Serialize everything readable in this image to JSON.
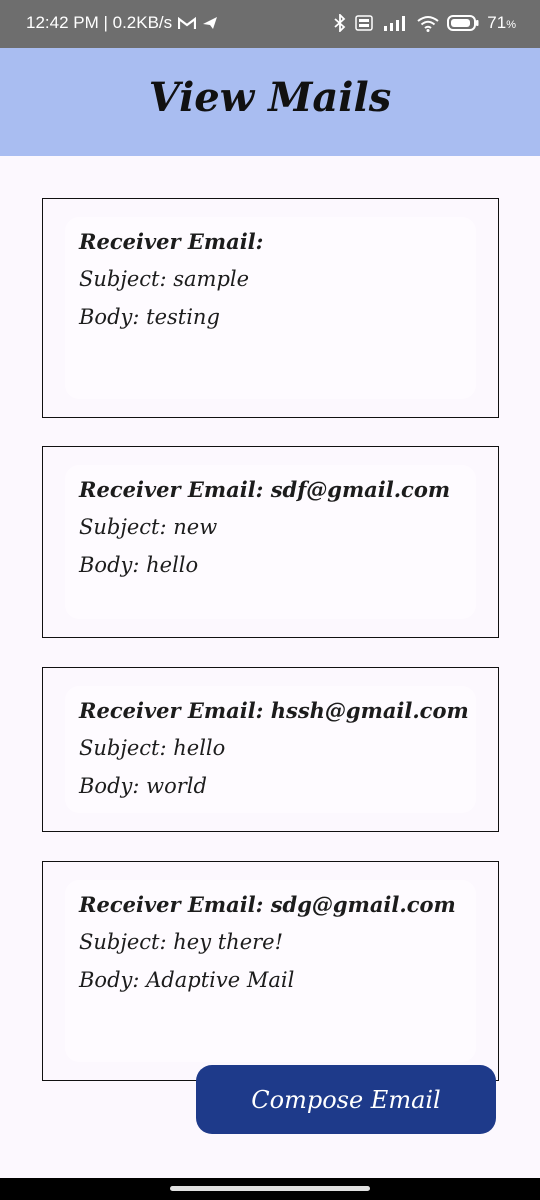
{
  "status_bar": {
    "time_speed": "12:42 PM | 0.2KB/s",
    "battery": "71",
    "battery_unit": "%",
    "icons": [
      "gmail-m-icon",
      "send-arrow-icon",
      "bluetooth-icon",
      "volte-icon",
      "signal-4g-icon",
      "wifi-icon",
      "battery-icon"
    ]
  },
  "app_bar": {
    "title": "View Mails"
  },
  "mails": [
    {
      "receiver": "Receiver Email:",
      "subject": "Subject: sample",
      "body": "Body: testing"
    },
    {
      "receiver": "Receiver Email: sdf@gmail.com",
      "subject": "Subject: new",
      "body": "Body: hello"
    },
    {
      "receiver": "Receiver Email: hssh@gmail.com",
      "subject": "Subject: hello",
      "body": "Body: world"
    },
    {
      "receiver": "Receiver Email: sdg@gmail.com",
      "subject": "Subject: hey there!",
      "body": "Body: Adaptive Mail"
    }
  ],
  "compose_button": {
    "label": "Compose Email"
  },
  "colors": {
    "app_bar": "#a9bdf1",
    "button": "#1e3a8a",
    "background": "#fcf8fe",
    "status_bar": "#6e6e6e"
  }
}
